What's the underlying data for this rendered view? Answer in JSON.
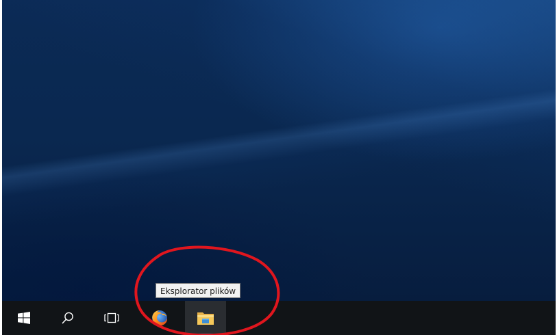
{
  "desktop": {
    "wallpaper": "windows-10-blue",
    "colors": {
      "wallpaper_base": "#0a2850",
      "taskbar": "#111417",
      "active_underline": "#76b9ed",
      "annotation": "#e0161e"
    }
  },
  "taskbar": {
    "buttons": [
      {
        "name": "start",
        "icon": "windows-logo-icon"
      },
      {
        "name": "search",
        "icon": "search-icon"
      },
      {
        "name": "task-view",
        "icon": "task-view-icon"
      },
      {
        "name": "firefox",
        "icon": "firefox-icon"
      },
      {
        "name": "file-explorer",
        "icon": "folder-icon",
        "active": true
      }
    ]
  },
  "tooltip": {
    "text": "Eksplorator plików"
  },
  "annotation": {
    "shape": "ellipse",
    "color": "#e0161e",
    "highlights": "file-explorer"
  }
}
